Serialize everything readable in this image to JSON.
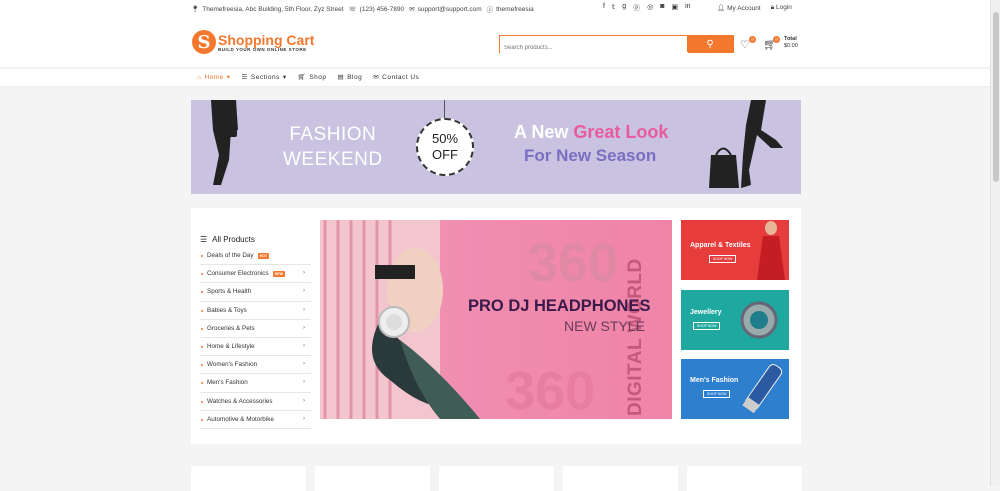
{
  "topbar": {
    "address": "Themefreesia, Abc Building, 5th Floor, Zyz Street",
    "phone": "(123) 456-7890",
    "email": "support@support.com",
    "skype": "themefreesia",
    "social_icons": [
      "facebook-icon",
      "twitter-icon",
      "google-plus-icon",
      "pinterest-icon",
      "dribbble-icon",
      "instagram-icon",
      "flickr-icon",
      "linkedin-icon"
    ],
    "my_account": "My Account",
    "login": "Login"
  },
  "header": {
    "logo_letter": "S",
    "logo_name": "Shopping Cart",
    "logo_tagline": "BUILD YOUR OWN ONLINE STORE",
    "search_placeholder": "Search products...",
    "wishlist_count": "0",
    "cart_count": "0",
    "total_label": "Total",
    "total_value": "$0.00"
  },
  "nav": {
    "items": [
      {
        "label": "Home",
        "icon": "home-icon",
        "active": true
      },
      {
        "label": "Sections",
        "icon": "menu-icon"
      },
      {
        "label": "Shop",
        "icon": "cart-icon"
      },
      {
        "label": "Blog",
        "icon": "blog-icon"
      },
      {
        "label": "Contact Us",
        "icon": "mail-icon"
      }
    ]
  },
  "promo": {
    "line1": "FASHION",
    "line2": "WEEKEND",
    "discount": "50%",
    "off": "OFF",
    "a_new": "A New",
    "great_look": "Great Look",
    "season": "For New Season"
  },
  "categories": {
    "title": "All Products",
    "items": [
      {
        "label": "Deals of the Day",
        "tag": "HOT"
      },
      {
        "label": "Consumer Electronics",
        "tag": "NEW"
      },
      {
        "label": "Sports & Health"
      },
      {
        "label": "Babies & Toys"
      },
      {
        "label": "Groceries & Pets"
      },
      {
        "label": "Home & Lifestyle"
      },
      {
        "label": "Women's Fashion"
      },
      {
        "label": "Men's Fashion"
      },
      {
        "label": "Watches & Accessories"
      },
      {
        "label": "Automotive & Motorbike"
      }
    ]
  },
  "hero": {
    "big_number_top": "360",
    "big_number_bottom": "360",
    "vertical": "DIGITAL WORLD",
    "title": "PRO DJ HEADPHONES",
    "subtitle": "NEW STYLE"
  },
  "tiles": [
    {
      "title": "Apparel & Textiles",
      "button": "SHOP NOW",
      "color": "#e63c3c"
    },
    {
      "title": "Jewellery",
      "button": "SHOP NOW",
      "color": "#1fa8a0"
    },
    {
      "title": "Men's Fashion",
      "button": "SHOP NOW",
      "color": "#2f7fcf"
    }
  ],
  "colors": {
    "accent": "#f4772e"
  }
}
